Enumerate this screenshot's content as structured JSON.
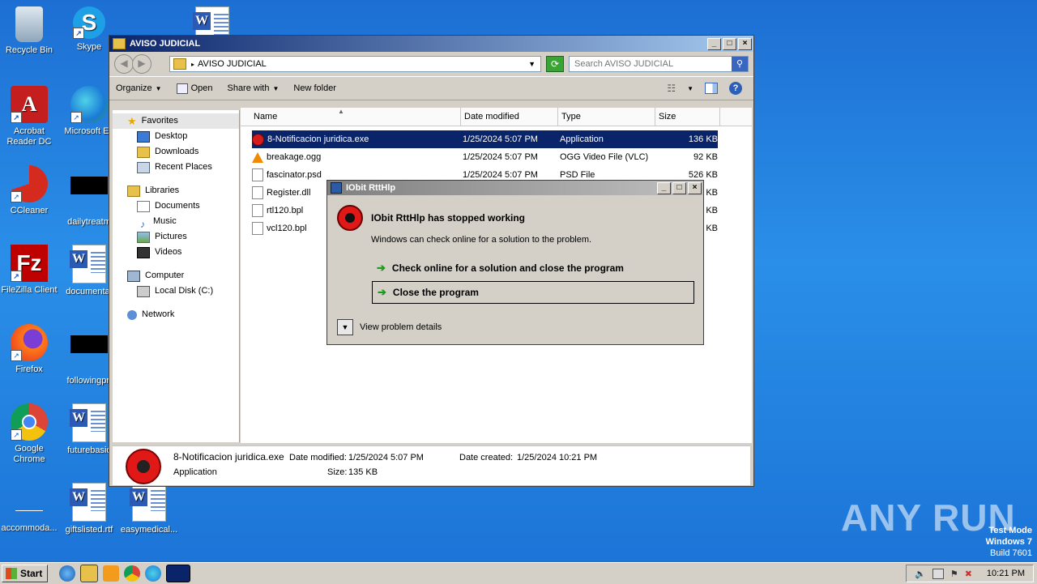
{
  "desktop": {
    "icons": [
      {
        "label": "Recycle Bin"
      },
      {
        "label": "Skype"
      },
      {
        "label": "Acrobat Reader DC"
      },
      {
        "label": "Microsoft Ed"
      },
      {
        "label": "CCleaner"
      },
      {
        "label": "dailytreatm"
      },
      {
        "label": "FileZilla Client"
      },
      {
        "label": "documentat"
      },
      {
        "label": "Firefox"
      },
      {
        "label": "followingpri"
      },
      {
        "label": "Google Chrome"
      },
      {
        "label": "futurebasic"
      },
      {
        "label": "accommoda..."
      },
      {
        "label": "giftslisted.rtf"
      },
      {
        "label": "easymedical..."
      }
    ]
  },
  "explorer": {
    "title": "AVISO JUDICIAL",
    "address": "AVISO JUDICIAL",
    "search_placeholder": "Search AVISO JUDICIAL",
    "toolbar": {
      "organize": "Organize",
      "open": "Open",
      "share": "Share with",
      "new_folder": "New folder"
    },
    "nav": {
      "favorites": "Favorites",
      "desktop": "Desktop",
      "downloads": "Downloads",
      "recent": "Recent Places",
      "libraries": "Libraries",
      "documents": "Documents",
      "music": "Music",
      "pictures": "Pictures",
      "videos": "Videos",
      "computer": "Computer",
      "localdisk": "Local Disk (C:)",
      "network": "Network"
    },
    "columns": {
      "name": "Name",
      "date": "Date modified",
      "type": "Type",
      "size": "Size"
    },
    "files": [
      {
        "name": "8-Notificacion juridica.exe",
        "date": "1/25/2024 5:07 PM",
        "type": "Application",
        "size": "136 KB"
      },
      {
        "name": "breakage.ogg",
        "date": "1/25/2024 5:07 PM",
        "type": "OGG Video File (VLC)",
        "size": "92 KB"
      },
      {
        "name": "fascinator.psd",
        "date": "1/25/2024 5:07 PM",
        "type": "PSD File",
        "size": "526 KB"
      },
      {
        "name": "Register.dll",
        "size": "KB"
      },
      {
        "name": "rtl120.bpl",
        "size": "KB"
      },
      {
        "name": "vcl120.bpl",
        "size": "KB"
      }
    ],
    "details": {
      "name": "8-Notificacion juridica.exe",
      "type": "Application",
      "modified_label": "Date modified:",
      "modified": "1/25/2024 5:07 PM",
      "size_label": "Size:",
      "size": "135 KB",
      "created_label": "Date created:",
      "created": "1/25/2024 10:21 PM"
    }
  },
  "dialog": {
    "title": "IObit RttHlp",
    "heading": "IObit RttHlp has stopped working",
    "message": "Windows can check online for a solution to the problem.",
    "option1": "Check online for a solution and close the program",
    "option2": "Close the program",
    "details": "View problem details"
  },
  "watermark": {
    "brand": "ANY RUN",
    "line1": "Test Mode",
    "line2": "Windows 7",
    "line3": "Build 7601"
  },
  "taskbar": {
    "start": "Start",
    "time": "10:21 PM"
  }
}
